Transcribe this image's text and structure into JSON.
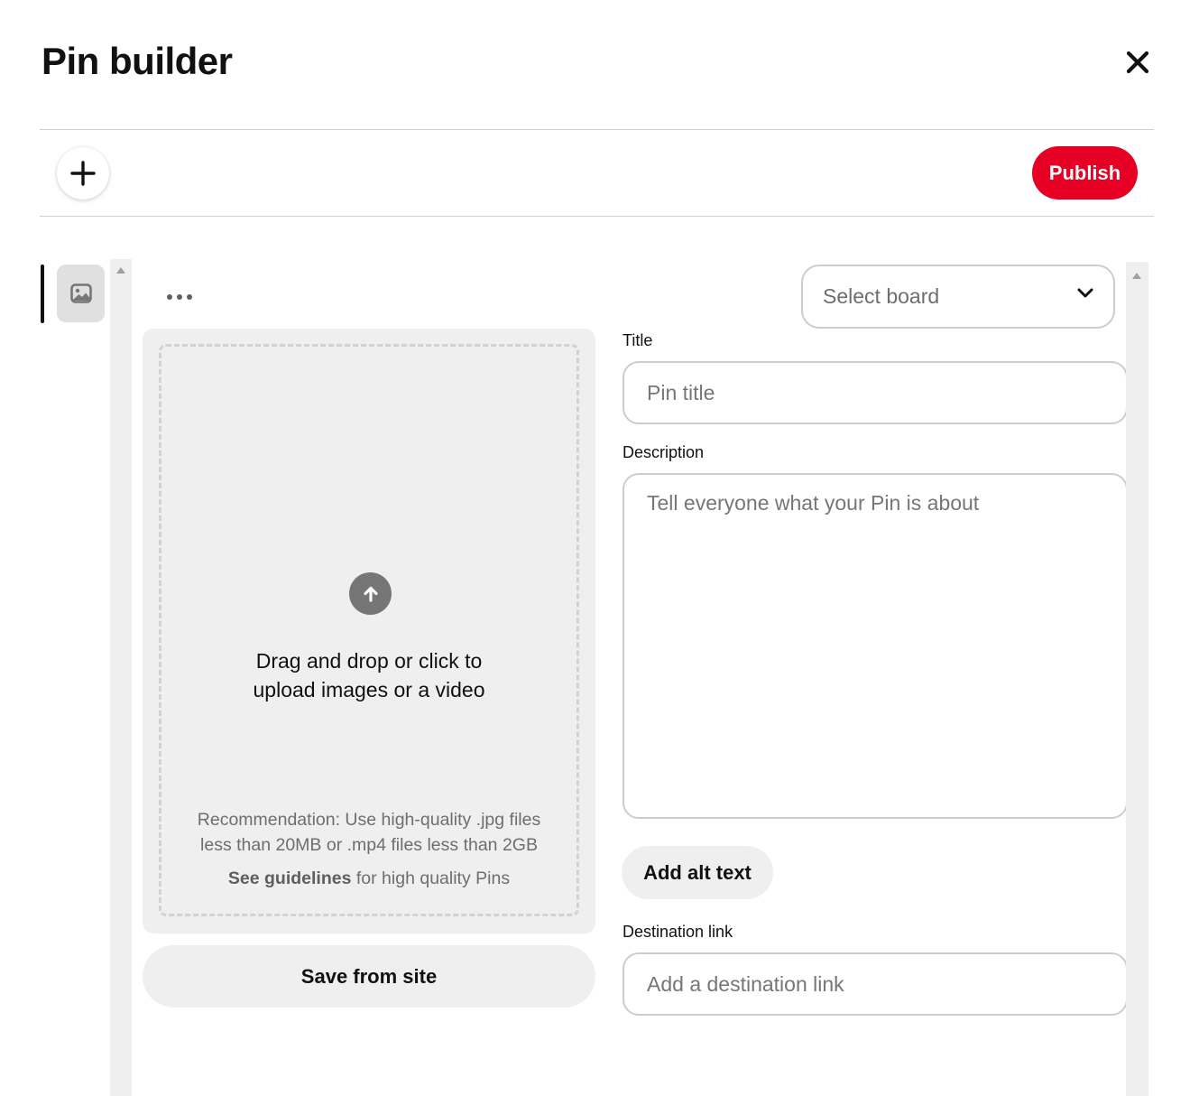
{
  "header": {
    "title": "Pin builder"
  },
  "toolbar": {
    "publish_label": "Publish"
  },
  "upload": {
    "line1": "Drag and drop or click to",
    "line2": "upload images or a video",
    "recommend_line1": "Recommendation: Use high-quality .jpg files",
    "recommend_line2": "less than 20MB or .mp4 files less than 2GB",
    "guidelines_link": "See guidelines",
    "guidelines_rest": " for high quality Pins",
    "save_from_site_label": "Save from site"
  },
  "form": {
    "board_select_value": "Select board",
    "title_label": "Title",
    "title_placeholder": "Pin title",
    "description_label": "Description",
    "description_placeholder": "Tell everyone what your Pin is about",
    "alt_text_label": "Add alt text",
    "destination_label": "Destination link",
    "destination_placeholder": "Add a destination link"
  },
  "colors": {
    "brand": "#e60023",
    "surface": "#efefef",
    "border": "#cdcdcd"
  },
  "icons": {
    "close": "close-icon",
    "add": "plus-icon",
    "thumbnail": "image-icon",
    "more": "more-icon",
    "upload": "upload-arrow-icon",
    "select": "chevron-down-icon"
  }
}
